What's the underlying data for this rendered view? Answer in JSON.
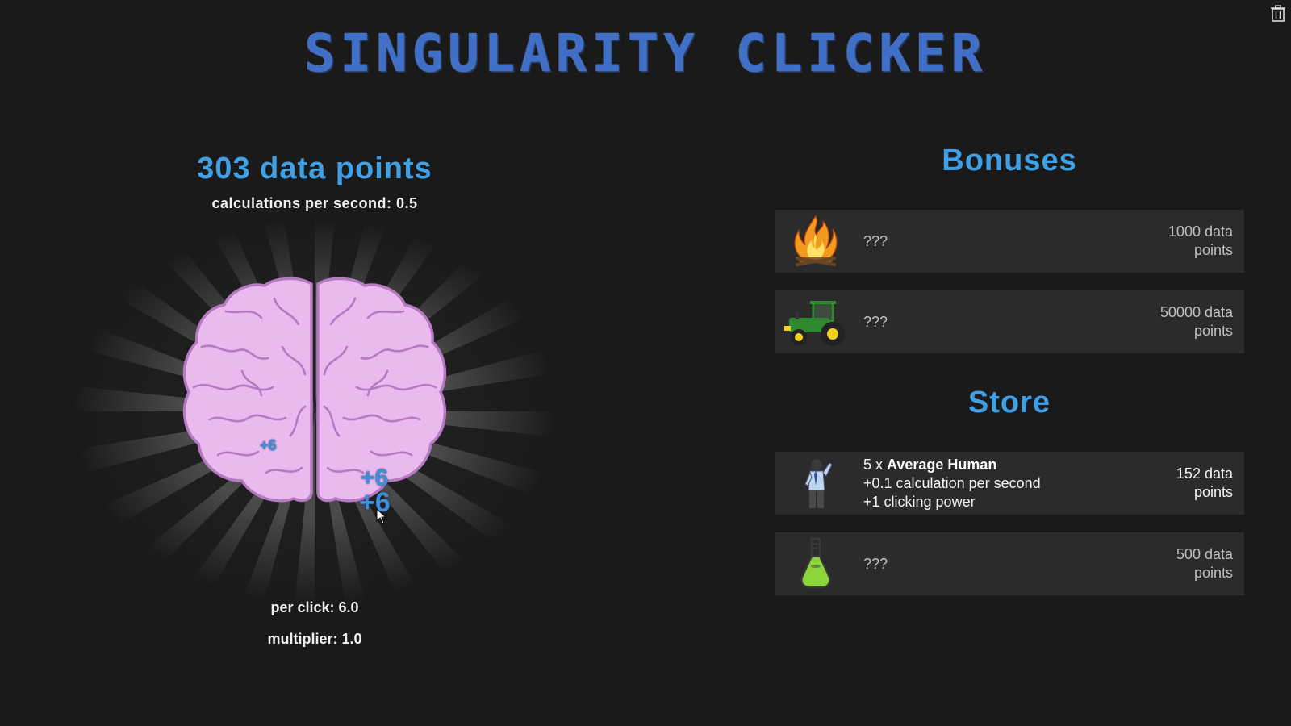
{
  "game": {
    "title": "SINGULARITY CLICKER"
  },
  "stats": {
    "points_label": "303 data points",
    "cps_label": "calculations per second: 0.5",
    "per_click_label": "per click: 6.0",
    "multiplier_label": "multiplier: 1.0"
  },
  "floaters": [
    "+6",
    "+6",
    "+6"
  ],
  "bonuses": {
    "heading": "Bonuses",
    "items": [
      {
        "icon": "campfire-icon",
        "name": "???",
        "price_line1": "1000 data",
        "price_line2": "points"
      },
      {
        "icon": "tractor-icon",
        "name": "???",
        "price_line1": "50000 data",
        "price_line2": "points"
      }
    ]
  },
  "store": {
    "heading": "Store",
    "items": [
      {
        "icon": "human-icon",
        "count_prefix": "5 x ",
        "name": "Average Human",
        "effect1": "+0.1 calculation per second",
        "effect2": "+1 clicking power",
        "price_line1": "152 data",
        "price_line2": "points"
      },
      {
        "icon": "flask-icon",
        "name": "???",
        "price_line1": "500 data",
        "price_line2": "points"
      }
    ]
  },
  "colors": {
    "background": "#1a1a1a",
    "accent": "#3fa0e6",
    "title": "#3f6fc6",
    "brain": "#eab9ee",
    "card": "#2b2b2b"
  }
}
